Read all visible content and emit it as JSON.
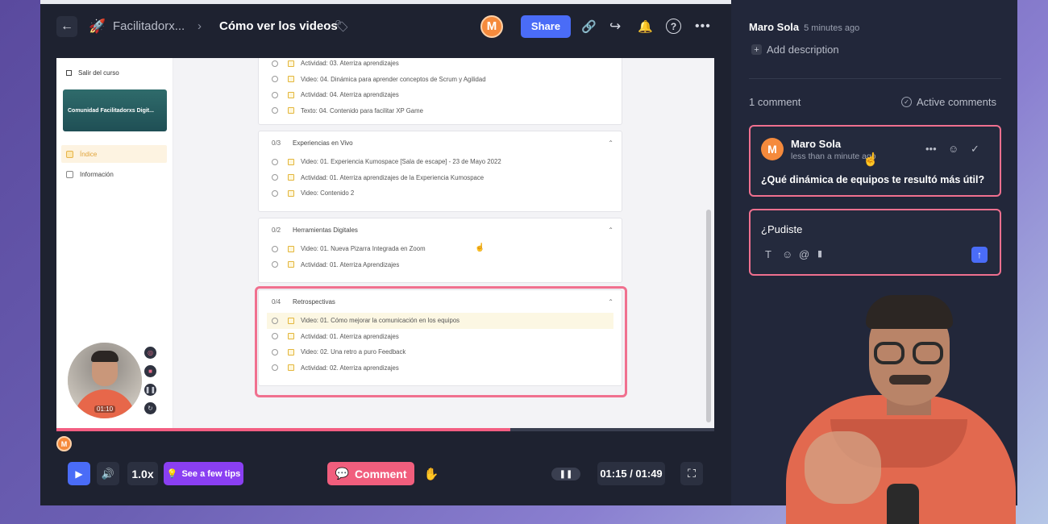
{
  "header": {
    "space_name": "Facilitadorx...",
    "title": "Cómo ver los videos",
    "avatar_initial": "M",
    "share_label": "Share",
    "icons": [
      "back-arrow-icon",
      "rocket-icon",
      "chevron-right-icon",
      "tag-icon",
      "link-icon",
      "forward-icon",
      "bell-icon",
      "help-icon",
      "more-icon"
    ]
  },
  "course": {
    "exit_label": "Salir del curso",
    "card_title": "Comunidad Facilitadorxs Digit...",
    "menu": [
      {
        "label": "Índice",
        "active": true
      },
      {
        "label": "Información",
        "active": false
      }
    ],
    "modules": [
      {
        "count": "",
        "title": "",
        "lessons": [
          "Actividad: 03. Aterriza aprendizajes",
          "Video: 04. Dinámica para aprender conceptos de Scrum y Agilidad",
          "Actividad: 04. Aterriza aprendizajes",
          "Texto: 04. Contenido para facilitar XP Game"
        ]
      },
      {
        "count": "0/3",
        "title": "Experiencias en Vivo",
        "lessons": [
          "Video: 01. Experiencia Kumospace [Sala de escape] - 23 de Mayo 2022",
          "Actividad: 01. Aterriza aprendizajes de la Experiencia Kumospace",
          "Video: Contenido 2"
        ]
      },
      {
        "count": "0/2",
        "title": "Herramientas Digitales",
        "lessons": [
          "Video: 01. Nueva Pizarra Integrada en Zoom",
          "Actividad: 01. Aterriza Aprendizajes"
        ]
      },
      {
        "count": "0/4",
        "title": "Retrospectivas",
        "lessons": [
          "Video: 01. Cómo mejorar la comunicación en los equipos",
          "Actividad: 01. Aterriza aprendizajes",
          "Video: 02. Una retro a puro Feedback",
          "Actividad: 02. Aterriza aprendizajes"
        ]
      }
    ],
    "bubble_time": "01:10"
  },
  "player": {
    "progress": 0.69,
    "marker_initial": "M",
    "speed": "1.0x",
    "tips_label": "See a few tips",
    "comment_label": "Comment",
    "time": "01:15 / 01:49",
    "icons": [
      "play-icon",
      "volume-icon",
      "lightbulb-icon",
      "comment-icon",
      "hand-wave-icon",
      "pause-icon",
      "fullscreen-icon"
    ]
  },
  "panel": {
    "author": "Maro Sola",
    "author_ago": "5 minutes ago",
    "add_description": "Add description",
    "comment_count": "1 comment",
    "active_comments": "Active comments",
    "comment": {
      "initial": "M",
      "name": "Maro Sola",
      "time": "less than a minute ago",
      "text": "¿Qué dinámica de equipos te resultó más útil?"
    },
    "reply_value": "¿Pudiste",
    "accent_color": "#f0708f",
    "brand_color": "#4a6cf7"
  }
}
